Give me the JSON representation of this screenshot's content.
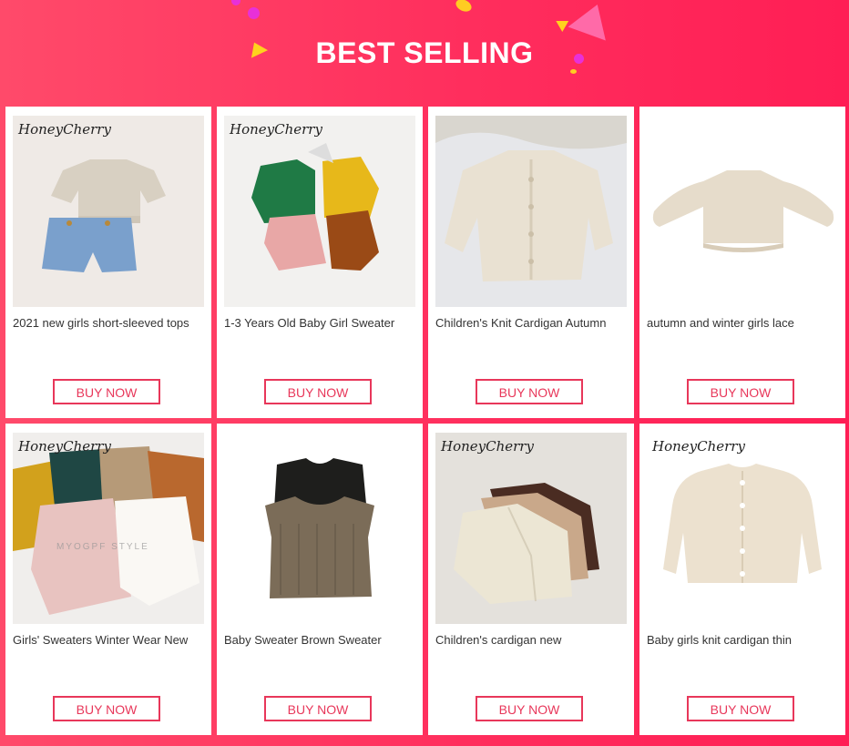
{
  "section_title": "BEST SELLING",
  "accent_color": "#e8375a",
  "products": [
    {
      "brand": "HoneyCherry",
      "name": "2021 new girls short-sleeved tops",
      "button": "BUY NOW",
      "image": "knit-top-and-denim-shorts"
    },
    {
      "brand": "HoneyCherry",
      "name": "1-3 Years Old Baby Girl Sweater",
      "button": "BUY NOW",
      "image": "four-colored-cardigans"
    },
    {
      "brand": "",
      "name": "Children's Knit Cardigan  Autumn",
      "button": "BUY NOW",
      "image": "cream-cable-knit-cardigan"
    },
    {
      "brand": "",
      "name": "autumn and winter girls lace",
      "button": "BUY NOW",
      "image": "lace-knit-sweater"
    },
    {
      "brand": "HoneyCherry",
      "name": "Girls' Sweaters Winter Wear New",
      "button": "BUY NOW",
      "image": "fluffy-sweaters-stack"
    },
    {
      "brand": "",
      "name": "Baby Sweater Brown Sweater",
      "button": "BUY NOW",
      "image": "knit-vests"
    },
    {
      "brand": "HoneyCherry",
      "name": "Children's cardigan new",
      "button": "BUY NOW",
      "image": "layered-cardigans"
    },
    {
      "brand": "HoneyCherry",
      "name": "Baby girls knit cardigan thin",
      "button": "BUY NOW",
      "image": "pointelle-cardigan"
    }
  ],
  "watermark": "MYOGPF STYLE"
}
